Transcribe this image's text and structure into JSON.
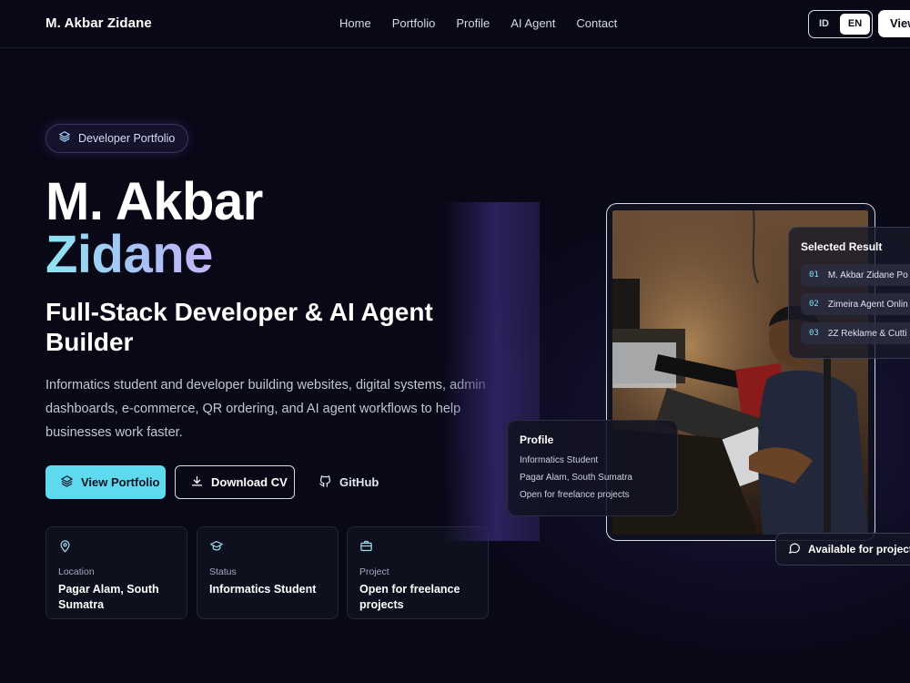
{
  "header": {
    "brand": "M. Akbar Zidane",
    "nav": [
      "Home",
      "Portfolio",
      "Profile",
      "AI Agent",
      "Contact"
    ],
    "lang_id": "ID",
    "lang_en": "EN",
    "cta": "View"
  },
  "hero": {
    "badge": "Developer Portfolio",
    "name_line1": "M. Akbar",
    "name_line2": "Zidane",
    "role": "Full-Stack Developer & AI Agent Builder",
    "description": "Informatics student and developer building websites, digital systems, admin dashboards, e-commerce, QR ordering, and AI agent workflows to help businesses work faster.",
    "btn_portfolio": "View Portfolio",
    "btn_cv": "Download CV",
    "btn_github": "GitHub"
  },
  "info_cards": [
    {
      "icon": "map-pin-icon",
      "label": "Location",
      "value": "Pagar Alam, South Sumatra"
    },
    {
      "icon": "graduation-cap-icon",
      "label": "Status",
      "value": "Informatics Student"
    },
    {
      "icon": "briefcase-icon",
      "label": "Project",
      "value": "Open for freelance projects"
    }
  ],
  "selected_result": {
    "title": "Selected Result",
    "items": [
      {
        "num": "01",
        "text": "M. Akbar Zidane Po"
      },
      {
        "num": "02",
        "text": "Zimeira Agent Onlin"
      },
      {
        "num": "03",
        "text": "2Z Reklame & Cutti"
      }
    ]
  },
  "profile_panel": {
    "title": "Profile",
    "lines": [
      "Informatics Student",
      "Pagar Alam, South Sumatra",
      "Open for freelance projects"
    ]
  },
  "availability": "Available for project",
  "colors": {
    "background": "#080816",
    "accent": "#5fd9ee",
    "gradient_start": "#8fe3f2",
    "gradient_end": "#c6b5f7"
  }
}
